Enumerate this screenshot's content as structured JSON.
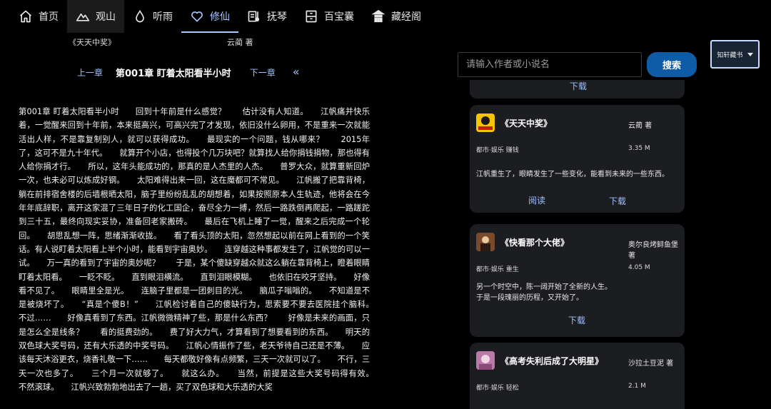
{
  "nav": {
    "items": [
      {
        "label": "首页",
        "icon": "home-icon"
      },
      {
        "label": "观山",
        "icon": "mountain-icon"
      },
      {
        "label": "听雨",
        "icon": "raindrop-icon"
      },
      {
        "label": "修仙",
        "icon": "heart-icon"
      },
      {
        "label": "抚琴",
        "icon": "music-note-icon"
      },
      {
        "label": "百宝囊",
        "icon": "storage-box-icon"
      },
      {
        "label": "藏经阁",
        "icon": "pavilion-icon"
      }
    ],
    "active_index": 3,
    "highlight_index": 1
  },
  "reader": {
    "book_title": "《天天中奖》",
    "book_author": "云蔺 著",
    "prev_label": "上一章",
    "chapter_title": "第001章 盯着太阳看半小时",
    "next_label": "下一章",
    "collapse_icon": "double-chevron-left-icon",
    "content": "第001章 盯着太阳看半小时　　回到十年前是什么感觉？　　估计没有人知道。　　江帆痛并快乐着，一觉醒来回到十年前，本来挺高兴，可高兴完了才发现，依旧没什么卵用，不是重来一次就能活出人样，不是靠复制别人，就可以获得成功。　　最现实的一个问题，钱从哪来？　　2015年了，这可不是九十年代。　　就算开个小店，也得投个几万块吧？就算找人给你捐钱捐物，那也得有人给你捐才行。　　所以，这年头能成功的，那真的是人杰里的人杰。　　普罗大众，就算重新回炉一次，也未必可以炼成好钢。　　太阳难得出来一回，这在魔都可不常见。　　江帆搬了把靠背椅，躺在前排宿舍楼的后墙根晒太阳，脑子里纷纷乱乱的胡想着，如果按照原本人生轨迹，他将会在今年年底辞职，离开这家混了三年日子的化工国企，奋尽全力一搏，然后一路跌倒再爬起，一路蹉跎到三十五，最终向现实妥协，准备回老家搬砖。　　最后在飞机上睡了一觉，醒来之后完成一个轮回。　　胡思乱想一阵，思绪渐渐收拢。　　看了看头顶的太阳，忽然想起以前在网上看到的一个笑话。有人说盯着太阳看上半个小时，能看到宇宙奥妙。　　连穿越这种事都发生了，江帆觉的可以一试。　　万一真的看到了宇宙的奥妙呢？　　于是，某个傻缺穿越众就这么躺在靠背椅上，瞪着眼睛盯着太阳看。　　一眨不眨。　　直到眼泪横流。　　直到泪眼模糊。　　也依旧在咬牙坚持。　　好像看不见了。　　眼睛里全是光。　　连脑子里都是一团刺目的光。　　脑瓜子嗡嗡的。　　不知道是不是被烧坏了。　　“真是个傻B！”　　江帆检讨着自己的傻缺行为，思索要不要去医院挂个脑科。　　不过……　　好像真看到了东西。江帆微微精神了些，那是什么东西？　　好像是未来的画面，只是怎么全是线条？　　看的挺费劲的。　　费了好大力气，才算看到了想要看到的东西。　　明天的双色球大奖号码，还有大乐透的中奖号码。　　江帆心情振作了些，老天爷待自己还是不薄。　　应该每天沐浴更衣，烧香礼敬一下……　　每天都敬好像有点频繁，三天一次就可以了。　　不行，三天一次也多了。　　三个月一次就够了。　　就这么办。　　当然，前提是这些大奖号码得有效。　　不然滚球。　　江帆兴致勃勃地出去了一趟，买了双色球和大乐透的大奖"
  },
  "search": {
    "placeholder": "请输入作者或小说名",
    "button_label": "搜索",
    "source_label": "知轩藏书"
  },
  "results": {
    "partial_action": "下载",
    "items": [
      {
        "title": "《天天中奖》",
        "author": "云蔺 著",
        "tags": "都市·娱乐 赚钱",
        "size": "3.35 M",
        "description": "江帆重生了，眼睛发生了一些变化，能看到未来的一些东西。",
        "actions": [
          "阅读",
          "下载"
        ],
        "cover_color": "#f6c400"
      },
      {
        "title": "《快看那个大佬》",
        "author": "奥尔良烤鲟鱼堡 著",
        "tags": "都市·娱乐 重生",
        "size": "4.05 M",
        "description": "另一个时空中，陈一阔开始了全新的人生。\n于是一段瑰丽的历程，又开始了。",
        "actions": [
          "下载"
        ],
        "cover_color": "#7a4a2c"
      },
      {
        "title": "《高考失利后成了大明星》",
        "author": "沙拉土豆泥 著",
        "tags": "都市·娱乐 轻松",
        "size": "2.1 M",
        "description": "",
        "actions": [],
        "cover_color": "#b87aa6"
      }
    ]
  }
}
